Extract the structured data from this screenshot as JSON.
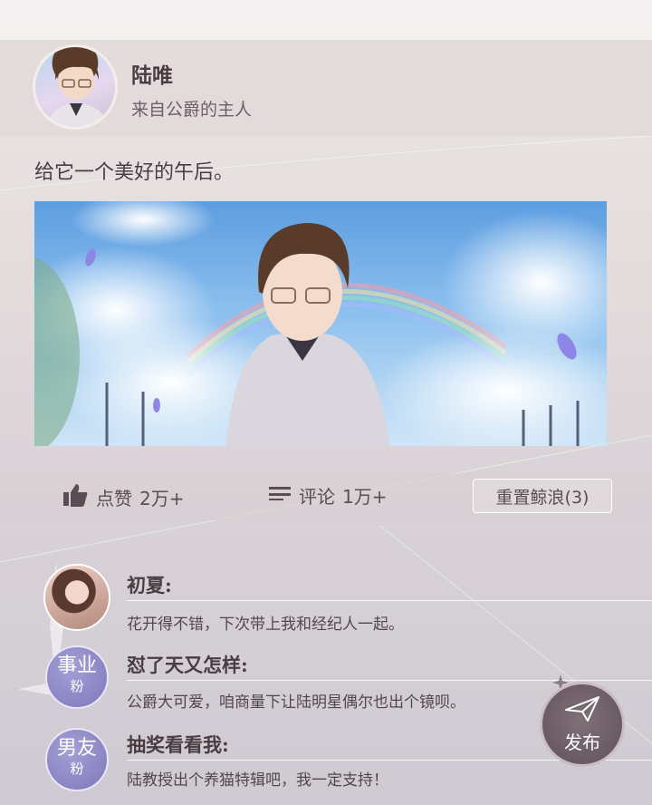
{
  "post": {
    "author": "陆唯",
    "author_subtitle": "来自公爵的主人",
    "text": "给它一个美好的午后。"
  },
  "actions": {
    "like_label": "点赞",
    "like_count": "2万+",
    "comment_label": "评论",
    "comment_count": "1万+",
    "reset_label": "重置鲸浪(3)"
  },
  "comments": [
    {
      "name": "初夏:",
      "text": "花开得不错，下次带上我和经纪人一起。"
    },
    {
      "name": "怼了天又怎样:",
      "text": "公爵大可爱，咱商量下让陆明星偶尔也出个镜呗。",
      "badge": [
        "事业",
        "粉"
      ]
    },
    {
      "name": "抽奖看看我:",
      "text": "陆教授出个养猫特辑吧，我一定支持！",
      "badge": [
        "男友",
        "粉"
      ]
    }
  ],
  "publish_label": "发布",
  "icons": [
    "thumbs-up-icon",
    "comment-lines-icon",
    "paper-plane-icon",
    "sparkle-icon"
  ]
}
